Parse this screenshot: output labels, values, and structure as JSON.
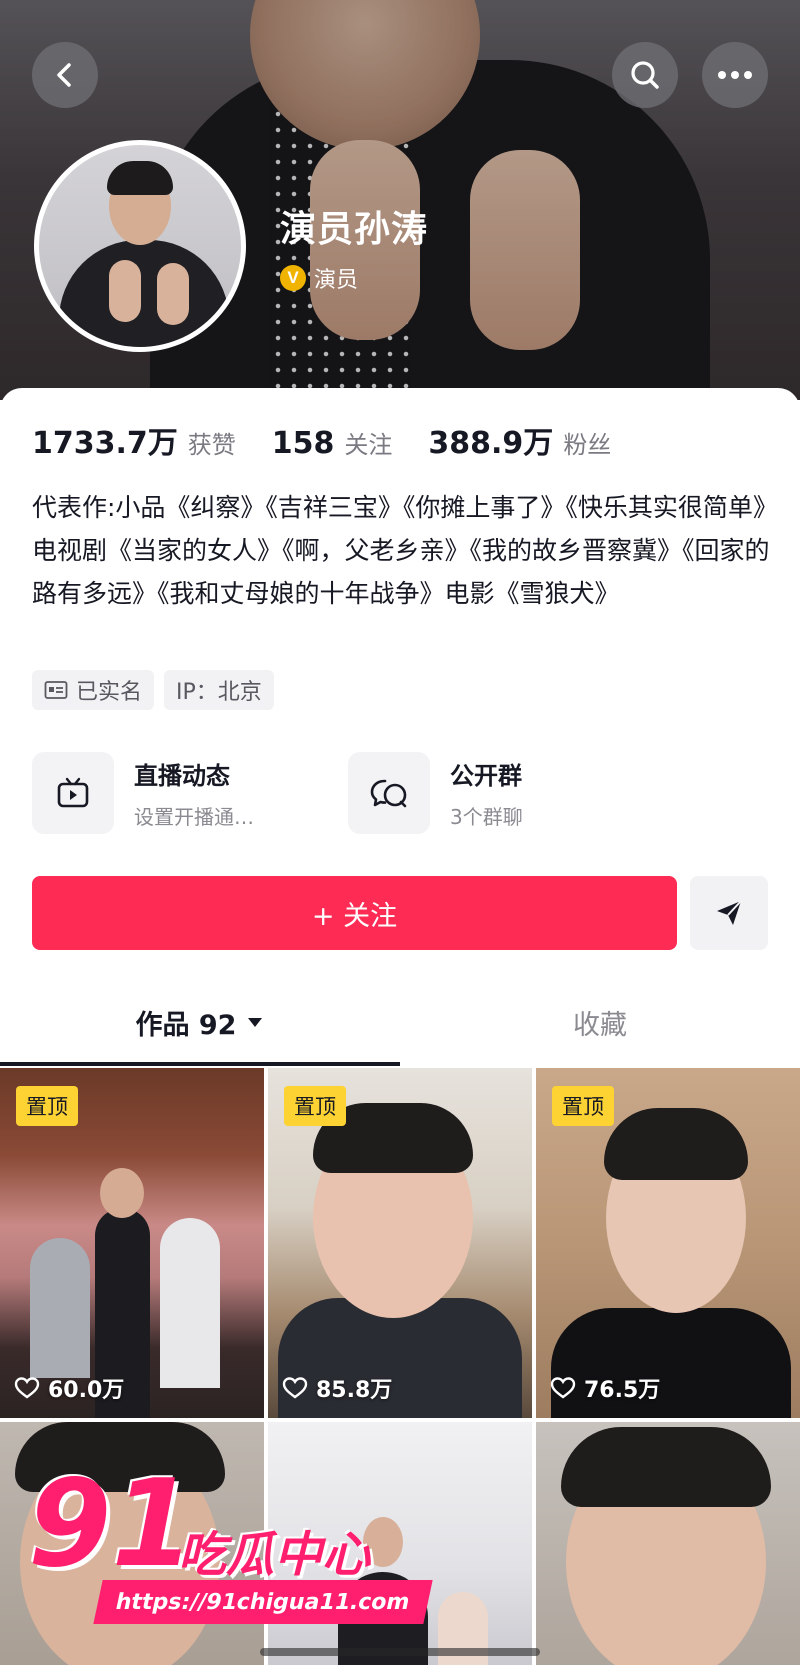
{
  "header": {
    "name": "演员孙涛",
    "verify_badge": "V",
    "verify_label": "演员"
  },
  "stats": [
    {
      "value": "1733.7万",
      "label": "获赞"
    },
    {
      "value": "158",
      "label": "关注"
    },
    {
      "value": "388.9万",
      "label": "粉丝"
    }
  ],
  "bio": "代表作:小品《纠察》《吉祥三宝》《你摊上事了》《快乐其实很简单》电视剧《当家的女人》《啊，父老乡亲》《我的故乡晋察冀》《回家的路有多远》《我和丈母娘的十年战争》电影《雪狼犬》",
  "tags": {
    "realname": "已实名",
    "ip": "IP：北京"
  },
  "features": {
    "live": {
      "title": "直播动态",
      "subtitle": "设置开播通…"
    },
    "group": {
      "title": "公开群",
      "subtitle": "3个群聊"
    }
  },
  "actions": {
    "follow_label": "+ 关注"
  },
  "tabs": {
    "works_label": "作品 92",
    "favorites_label": "收藏"
  },
  "videos": [
    {
      "pinned": "置顶",
      "likes": "60.0万"
    },
    {
      "pinned": "置顶",
      "likes": "85.8万"
    },
    {
      "pinned": "置顶",
      "likes": "76.5万"
    },
    {
      "pinned": "",
      "likes": ""
    },
    {
      "pinned": "",
      "likes": ""
    },
    {
      "pinned": "",
      "likes": ""
    }
  ],
  "watermark": {
    "logo": "91",
    "text": "吃瓜中心",
    "url": "https://91chigua11.com"
  },
  "colors": {
    "accent": "#fe2c55",
    "pin": "#fdd334",
    "verify": "#f0b400",
    "watermark": "#ff1f6e"
  }
}
